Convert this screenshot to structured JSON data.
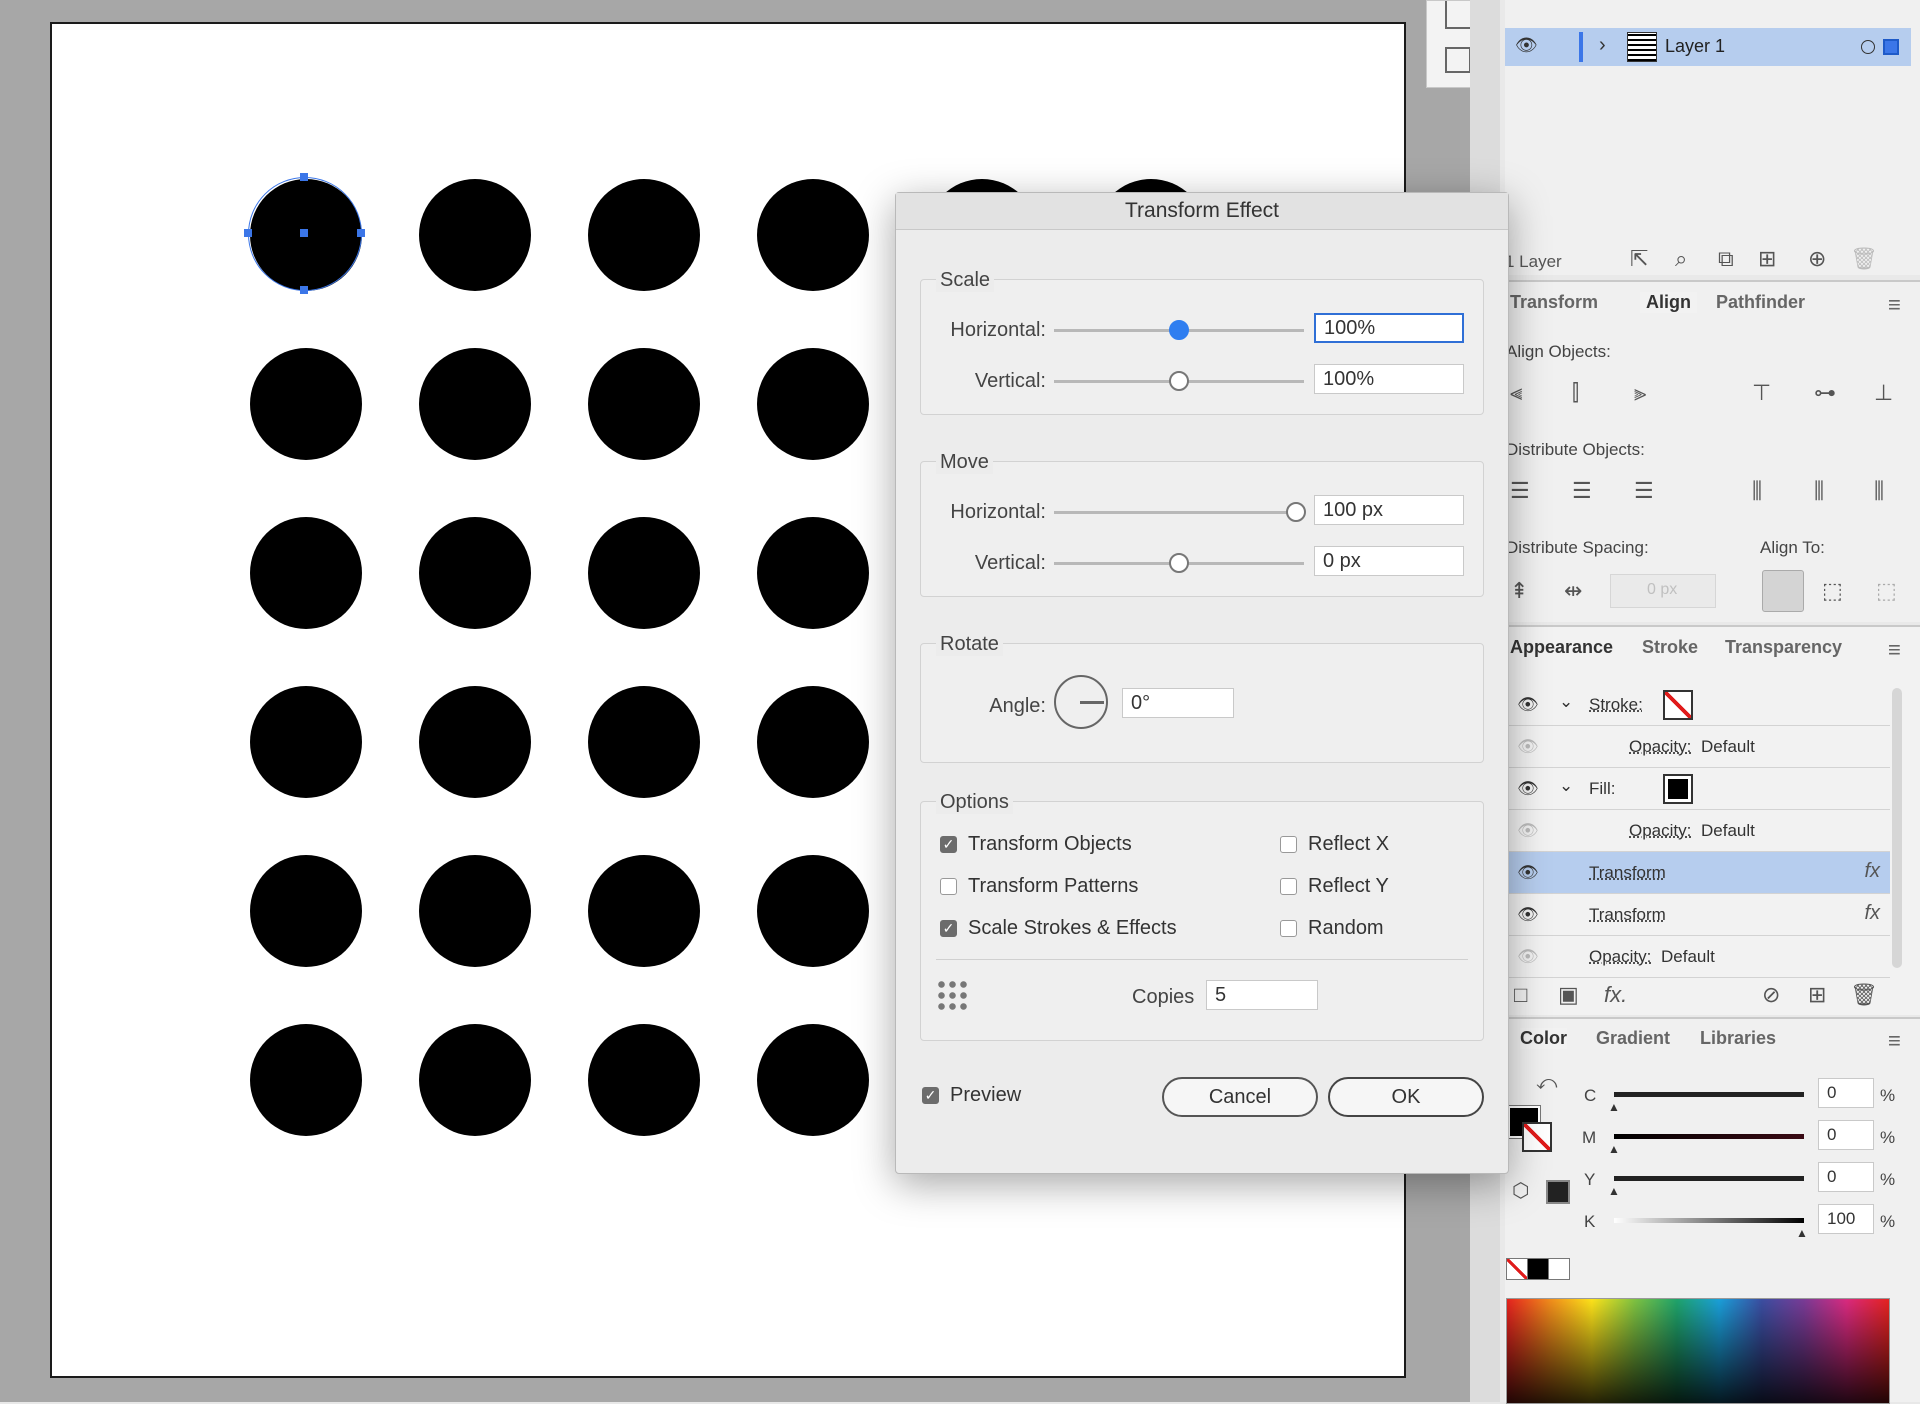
{
  "dialog": {
    "title": "Transform Effect",
    "scale": {
      "title": "Scale",
      "horizontal_label": "Horizontal:",
      "horizontal_value": "100%",
      "vertical_label": "Vertical:",
      "vertical_value": "100%"
    },
    "move": {
      "title": "Move",
      "horizontal_label": "Horizontal:",
      "horizontal_value": "100 px",
      "vertical_label": "Vertical:",
      "vertical_value": "0 px"
    },
    "rotate": {
      "title": "Rotate",
      "angle_label": "Angle:",
      "angle_value": "0°"
    },
    "options": {
      "title": "Options",
      "transform_objects": "Transform Objects",
      "transform_patterns": "Transform Patterns",
      "scale_strokes": "Scale Strokes & Effects",
      "reflect_x": "Reflect X",
      "reflect_y": "Reflect Y",
      "random": "Random",
      "copies_label": "Copies",
      "copies_value": "5"
    },
    "preview_label": "Preview",
    "cancel_label": "Cancel",
    "ok_label": "OK"
  },
  "layers": {
    "layer_name": "Layer 1",
    "count_label": "1 Layer"
  },
  "align_panel": {
    "tabs": [
      "Transform",
      "Align",
      "Pathfinder"
    ],
    "align_objects": "Align Objects:",
    "distribute_objects": "Distribute Objects:",
    "distribute_spacing": "Distribute Spacing:",
    "align_to": "Align To:",
    "spacing_value": "0 px"
  },
  "appearance_panel": {
    "tabs": [
      "Appearance",
      "Stroke",
      "Transparency"
    ],
    "stroke_label": "Stroke:",
    "opacity_label": "Opacity:",
    "opacity_value": "Default",
    "fill_label": "Fill:",
    "transform1": "Transform",
    "transform2": "Transform",
    "fx_label": "fx"
  },
  "color_panel": {
    "tabs": [
      "Color",
      "Gradient",
      "Libraries"
    ],
    "c_label": "C",
    "c_value": "0",
    "m_label": "M",
    "m_value": "0",
    "y_label": "Y",
    "y_value": "0",
    "k_label": "K",
    "k_value": "100",
    "pct": "%"
  },
  "colors": {
    "accent": "#2f7ef0",
    "selection": "#b6cdee",
    "dot": "#000000"
  }
}
